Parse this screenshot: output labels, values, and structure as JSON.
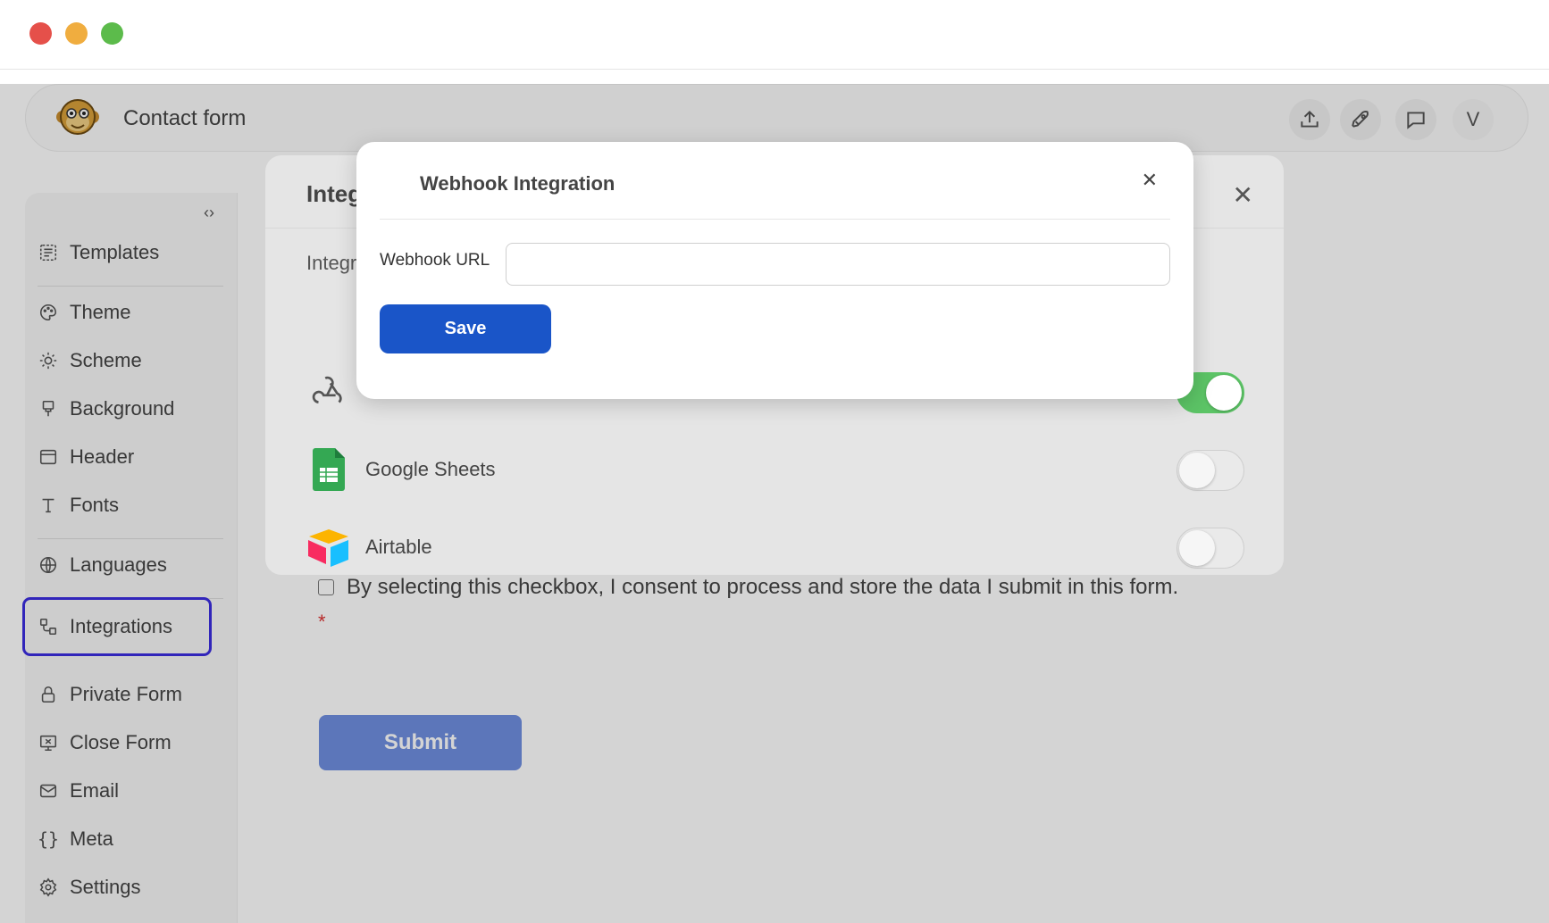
{
  "app": {
    "title": "Contact form",
    "avatar_initial": "V"
  },
  "sidebar": {
    "items": [
      {
        "label": "Templates",
        "icon": "template-icon"
      },
      {
        "label": "Theme",
        "icon": "palette-icon"
      },
      {
        "label": "Scheme",
        "icon": "sun-icon"
      },
      {
        "label": "Background",
        "icon": "brush-icon"
      },
      {
        "label": "Header",
        "icon": "header-icon"
      },
      {
        "label": "Fonts",
        "icon": "font-icon"
      },
      {
        "label": "Languages",
        "icon": "globe-icon"
      },
      {
        "label": "Integrations",
        "icon": "integrations-icon",
        "active": true
      },
      {
        "label": "Private Form",
        "icon": "lock-icon"
      },
      {
        "label": "Close Form",
        "icon": "close-form-icon"
      },
      {
        "label": "Email",
        "icon": "mail-icon"
      },
      {
        "label": "Meta",
        "icon": "braces-icon"
      },
      {
        "label": "Settings",
        "icon": "gear-icon"
      }
    ]
  },
  "form": {
    "consent_text": "By selecting this checkbox, I consent to process and store the data I submit in this form.",
    "required_mark": "*",
    "submit_label": "Submit"
  },
  "integrations_panel": {
    "title": "Integ",
    "subtitle": "Integr",
    "items": [
      {
        "label": "",
        "icon": "webhook-icon",
        "enabled": true
      },
      {
        "label": "Google Sheets",
        "icon": "google-sheets-icon",
        "enabled": false
      },
      {
        "label": "Airtable",
        "icon": "airtable-icon",
        "enabled": false
      }
    ]
  },
  "webhook_modal": {
    "title": "Webhook Integration",
    "url_label": "Webhook URL",
    "url_value": "",
    "save_label": "Save"
  },
  "colors": {
    "primary": "#1a55c8",
    "toggle_on": "#5cc466",
    "active_outline": "#3b2de0"
  }
}
